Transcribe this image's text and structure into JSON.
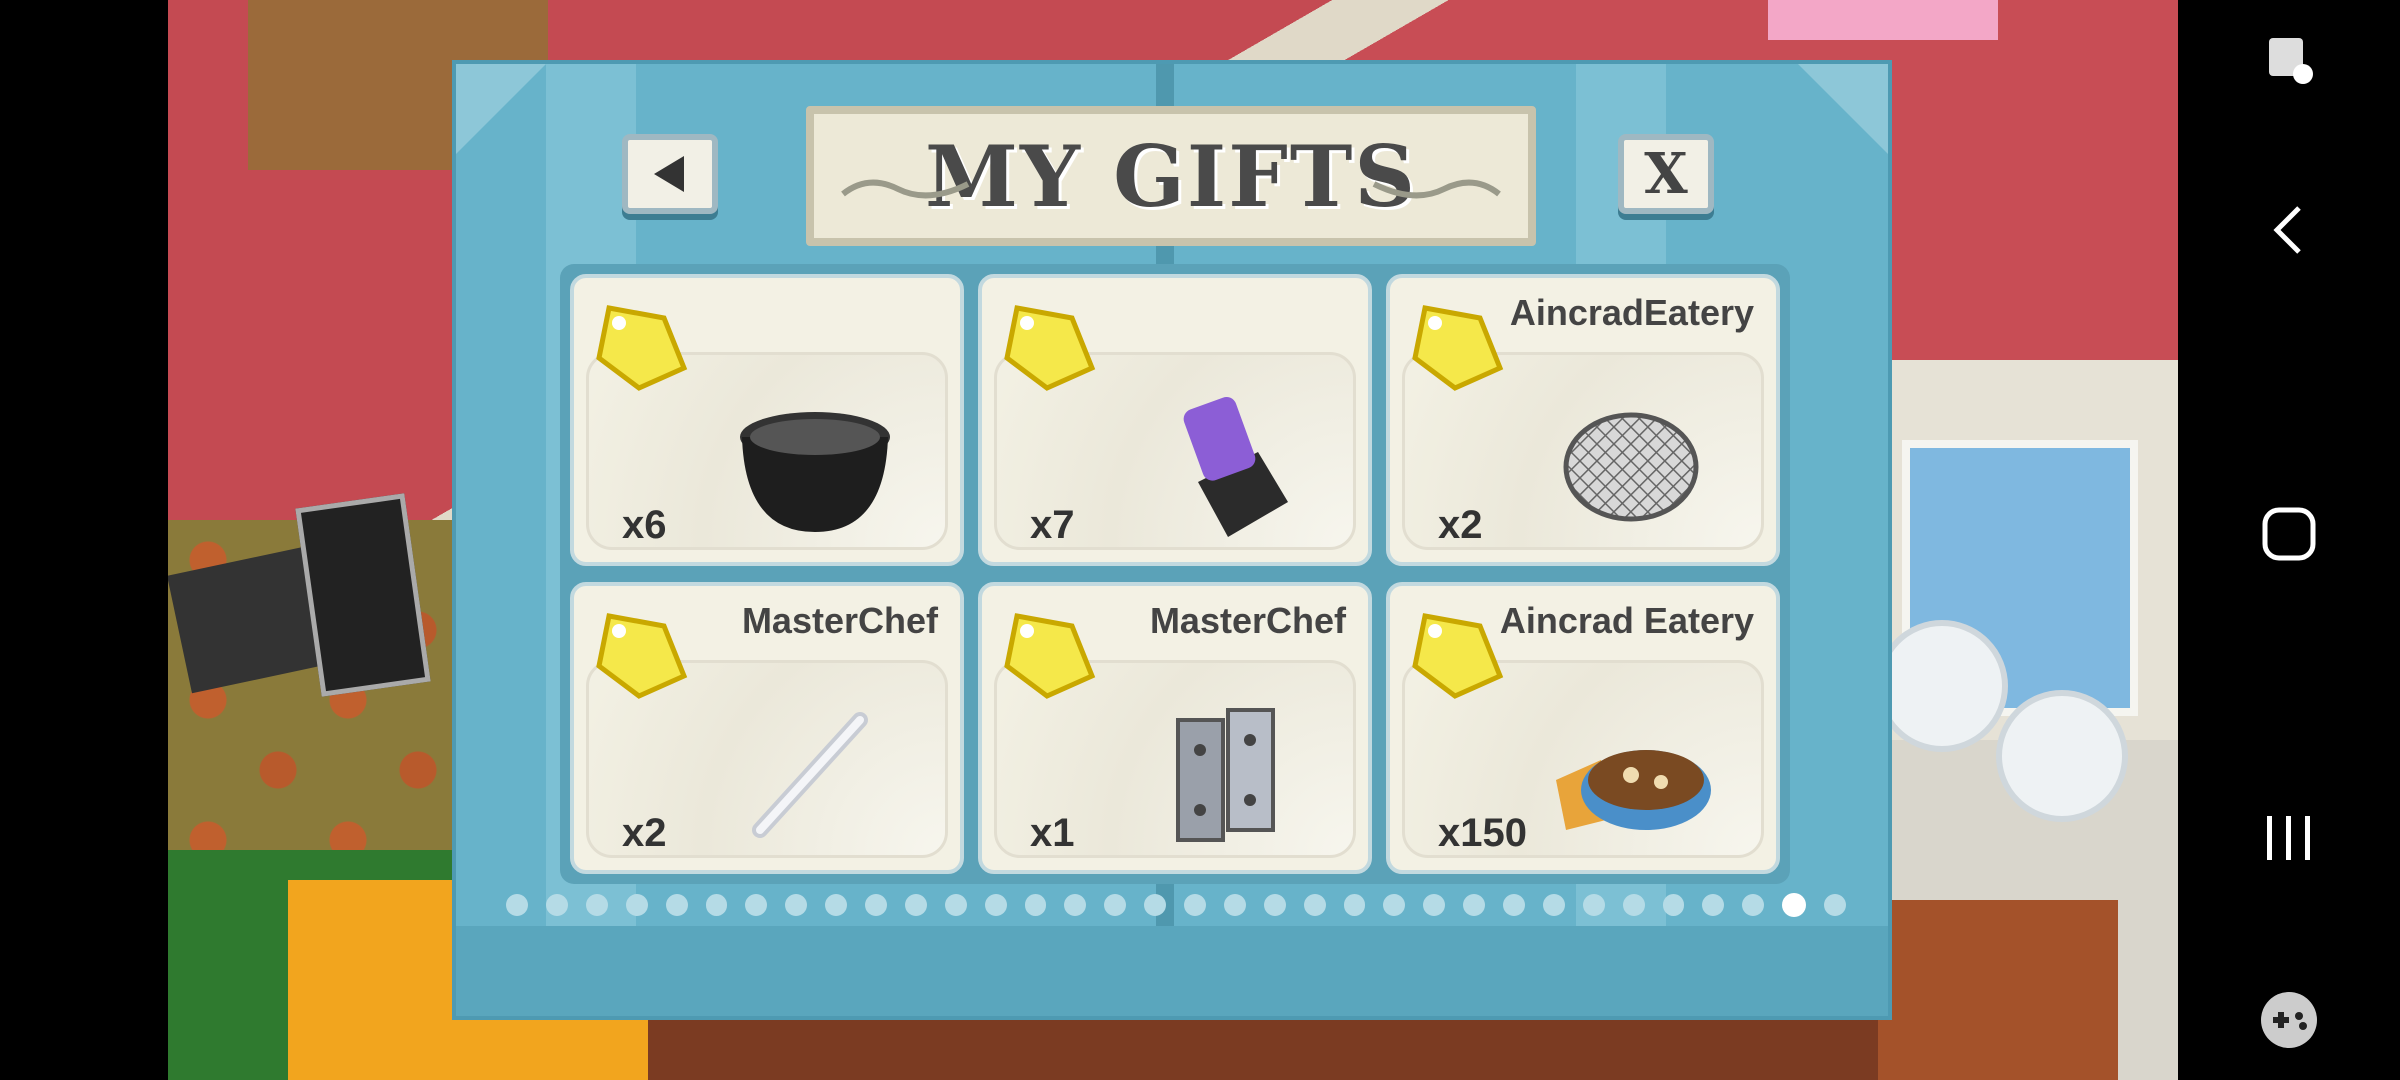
{
  "dialog": {
    "title": "MY GIFTS",
    "close_label": "X",
    "back_icon": "back-arrow-icon",
    "pager": {
      "total": 34,
      "active_index": 32
    }
  },
  "gifts": [
    {
      "sender": "",
      "quantity": "x6",
      "item_icon": "pot-icon"
    },
    {
      "sender": "",
      "quantity": "x7",
      "item_icon": "knob-icon"
    },
    {
      "sender": "AincradEatery",
      "quantity": "x2",
      "item_icon": "grill-grate-icon"
    },
    {
      "sender": "MasterChef",
      "quantity": "x2",
      "item_icon": "handle-icon"
    },
    {
      "sender": "MasterChef",
      "quantity": "x1",
      "item_icon": "hinge-icon"
    },
    {
      "sender": "Aincrad Eatery",
      "quantity": "x150",
      "item_icon": "soup-bowl-icon"
    }
  ],
  "navbar": {
    "icons": [
      "screen-lock-icon",
      "back-nav-icon",
      "home-nav-icon",
      "recents-nav-icon",
      "game-tools-icon"
    ]
  },
  "colors": {
    "dialog_bg": "#67b3ca",
    "card_bg": "#f3f1e4",
    "tag": "#f5e84a"
  }
}
